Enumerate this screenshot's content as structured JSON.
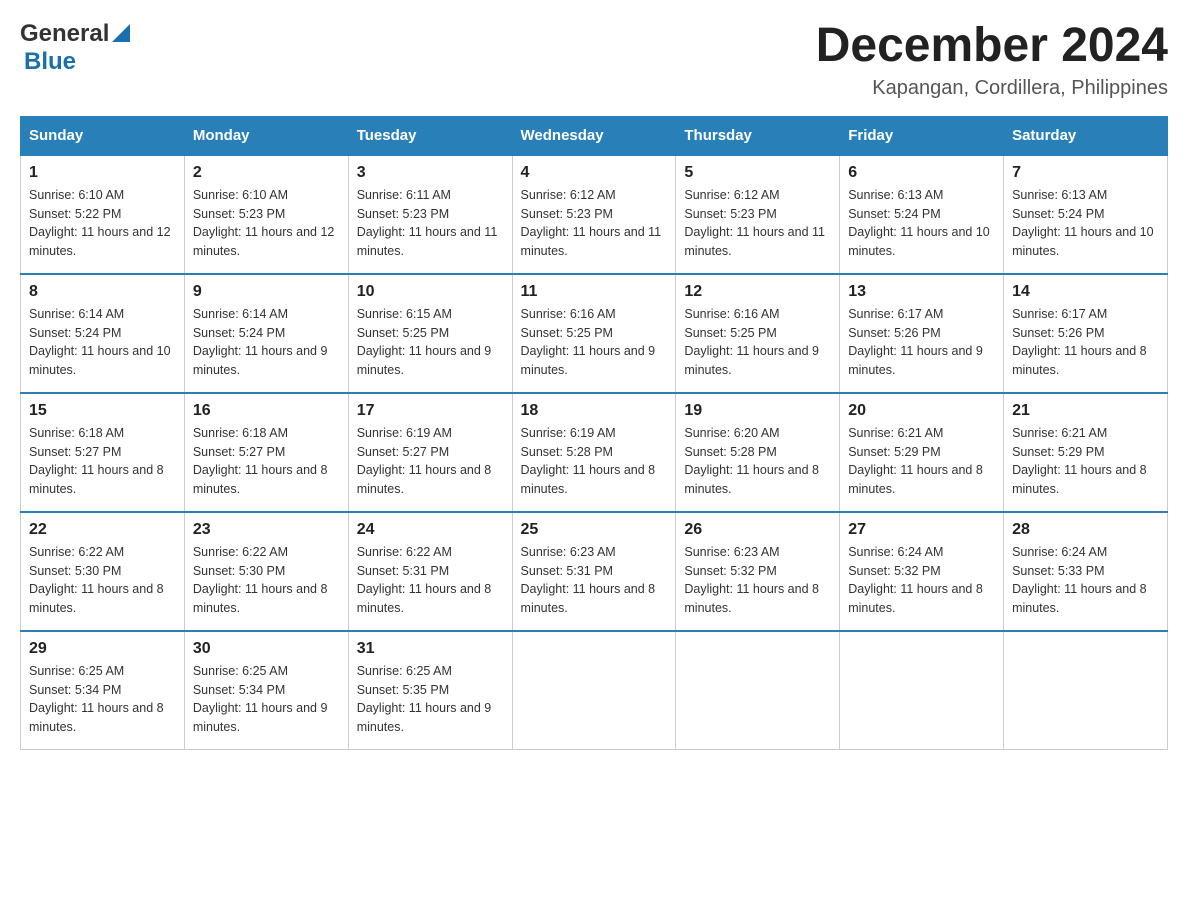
{
  "header": {
    "logo_general": "General",
    "logo_blue": "Blue",
    "month_title": "December 2024",
    "location": "Kapangan, Cordillera, Philippines"
  },
  "days_of_week": [
    "Sunday",
    "Monday",
    "Tuesday",
    "Wednesday",
    "Thursday",
    "Friday",
    "Saturday"
  ],
  "weeks": [
    [
      {
        "day": "1",
        "sunrise": "Sunrise: 6:10 AM",
        "sunset": "Sunset: 5:22 PM",
        "daylight": "Daylight: 11 hours and 12 minutes."
      },
      {
        "day": "2",
        "sunrise": "Sunrise: 6:10 AM",
        "sunset": "Sunset: 5:23 PM",
        "daylight": "Daylight: 11 hours and 12 minutes."
      },
      {
        "day": "3",
        "sunrise": "Sunrise: 6:11 AM",
        "sunset": "Sunset: 5:23 PM",
        "daylight": "Daylight: 11 hours and 11 minutes."
      },
      {
        "day": "4",
        "sunrise": "Sunrise: 6:12 AM",
        "sunset": "Sunset: 5:23 PM",
        "daylight": "Daylight: 11 hours and 11 minutes."
      },
      {
        "day": "5",
        "sunrise": "Sunrise: 6:12 AM",
        "sunset": "Sunset: 5:23 PM",
        "daylight": "Daylight: 11 hours and 11 minutes."
      },
      {
        "day": "6",
        "sunrise": "Sunrise: 6:13 AM",
        "sunset": "Sunset: 5:24 PM",
        "daylight": "Daylight: 11 hours and 10 minutes."
      },
      {
        "day": "7",
        "sunrise": "Sunrise: 6:13 AM",
        "sunset": "Sunset: 5:24 PM",
        "daylight": "Daylight: 11 hours and 10 minutes."
      }
    ],
    [
      {
        "day": "8",
        "sunrise": "Sunrise: 6:14 AM",
        "sunset": "Sunset: 5:24 PM",
        "daylight": "Daylight: 11 hours and 10 minutes."
      },
      {
        "day": "9",
        "sunrise": "Sunrise: 6:14 AM",
        "sunset": "Sunset: 5:24 PM",
        "daylight": "Daylight: 11 hours and 9 minutes."
      },
      {
        "day": "10",
        "sunrise": "Sunrise: 6:15 AM",
        "sunset": "Sunset: 5:25 PM",
        "daylight": "Daylight: 11 hours and 9 minutes."
      },
      {
        "day": "11",
        "sunrise": "Sunrise: 6:16 AM",
        "sunset": "Sunset: 5:25 PM",
        "daylight": "Daylight: 11 hours and 9 minutes."
      },
      {
        "day": "12",
        "sunrise": "Sunrise: 6:16 AM",
        "sunset": "Sunset: 5:25 PM",
        "daylight": "Daylight: 11 hours and 9 minutes."
      },
      {
        "day": "13",
        "sunrise": "Sunrise: 6:17 AM",
        "sunset": "Sunset: 5:26 PM",
        "daylight": "Daylight: 11 hours and 9 minutes."
      },
      {
        "day": "14",
        "sunrise": "Sunrise: 6:17 AM",
        "sunset": "Sunset: 5:26 PM",
        "daylight": "Daylight: 11 hours and 8 minutes."
      }
    ],
    [
      {
        "day": "15",
        "sunrise": "Sunrise: 6:18 AM",
        "sunset": "Sunset: 5:27 PM",
        "daylight": "Daylight: 11 hours and 8 minutes."
      },
      {
        "day": "16",
        "sunrise": "Sunrise: 6:18 AM",
        "sunset": "Sunset: 5:27 PM",
        "daylight": "Daylight: 11 hours and 8 minutes."
      },
      {
        "day": "17",
        "sunrise": "Sunrise: 6:19 AM",
        "sunset": "Sunset: 5:27 PM",
        "daylight": "Daylight: 11 hours and 8 minutes."
      },
      {
        "day": "18",
        "sunrise": "Sunrise: 6:19 AM",
        "sunset": "Sunset: 5:28 PM",
        "daylight": "Daylight: 11 hours and 8 minutes."
      },
      {
        "day": "19",
        "sunrise": "Sunrise: 6:20 AM",
        "sunset": "Sunset: 5:28 PM",
        "daylight": "Daylight: 11 hours and 8 minutes."
      },
      {
        "day": "20",
        "sunrise": "Sunrise: 6:21 AM",
        "sunset": "Sunset: 5:29 PM",
        "daylight": "Daylight: 11 hours and 8 minutes."
      },
      {
        "day": "21",
        "sunrise": "Sunrise: 6:21 AM",
        "sunset": "Sunset: 5:29 PM",
        "daylight": "Daylight: 11 hours and 8 minutes."
      }
    ],
    [
      {
        "day": "22",
        "sunrise": "Sunrise: 6:22 AM",
        "sunset": "Sunset: 5:30 PM",
        "daylight": "Daylight: 11 hours and 8 minutes."
      },
      {
        "day": "23",
        "sunrise": "Sunrise: 6:22 AM",
        "sunset": "Sunset: 5:30 PM",
        "daylight": "Daylight: 11 hours and 8 minutes."
      },
      {
        "day": "24",
        "sunrise": "Sunrise: 6:22 AM",
        "sunset": "Sunset: 5:31 PM",
        "daylight": "Daylight: 11 hours and 8 minutes."
      },
      {
        "day": "25",
        "sunrise": "Sunrise: 6:23 AM",
        "sunset": "Sunset: 5:31 PM",
        "daylight": "Daylight: 11 hours and 8 minutes."
      },
      {
        "day": "26",
        "sunrise": "Sunrise: 6:23 AM",
        "sunset": "Sunset: 5:32 PM",
        "daylight": "Daylight: 11 hours and 8 minutes."
      },
      {
        "day": "27",
        "sunrise": "Sunrise: 6:24 AM",
        "sunset": "Sunset: 5:32 PM",
        "daylight": "Daylight: 11 hours and 8 minutes."
      },
      {
        "day": "28",
        "sunrise": "Sunrise: 6:24 AM",
        "sunset": "Sunset: 5:33 PM",
        "daylight": "Daylight: 11 hours and 8 minutes."
      }
    ],
    [
      {
        "day": "29",
        "sunrise": "Sunrise: 6:25 AM",
        "sunset": "Sunset: 5:34 PM",
        "daylight": "Daylight: 11 hours and 8 minutes."
      },
      {
        "day": "30",
        "sunrise": "Sunrise: 6:25 AM",
        "sunset": "Sunset: 5:34 PM",
        "daylight": "Daylight: 11 hours and 9 minutes."
      },
      {
        "day": "31",
        "sunrise": "Sunrise: 6:25 AM",
        "sunset": "Sunset: 5:35 PM",
        "daylight": "Daylight: 11 hours and 9 minutes."
      },
      null,
      null,
      null,
      null
    ]
  ]
}
